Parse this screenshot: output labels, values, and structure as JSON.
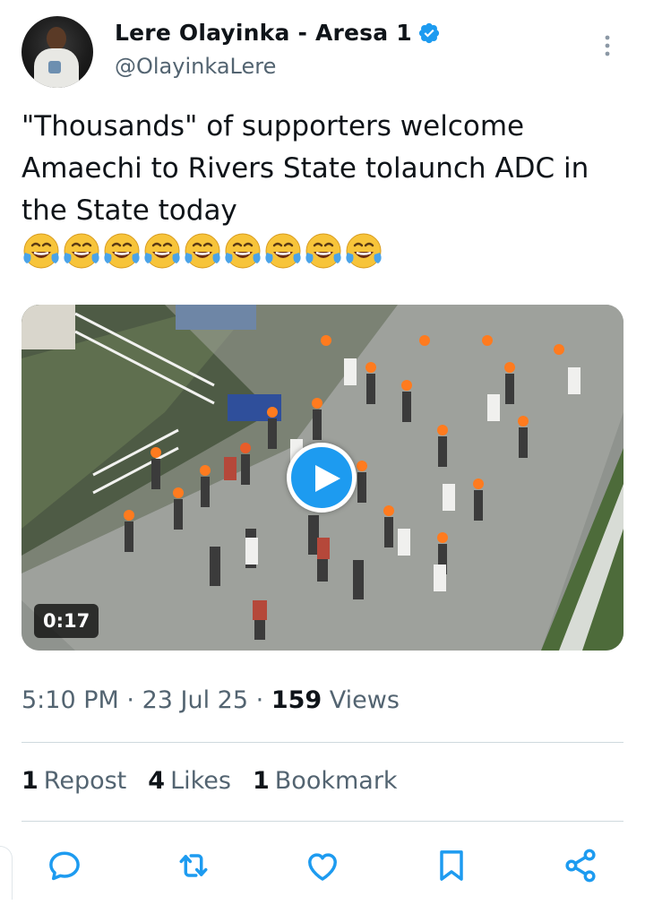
{
  "author": {
    "display_name": "Lere Olayinka - Aresa 1",
    "handle": "@OlayinkaLere",
    "verified": true,
    "avatar_icon": "profile-photo"
  },
  "tweet": {
    "text": "\"Thousands\" of supporters welcome Amaechi to Rivers State tolaunch ADC in the State today",
    "emojis": [
      "😂",
      "😂",
      "😂",
      "😂",
      "😂",
      "😂",
      "😂",
      "😂",
      "😂"
    ]
  },
  "media": {
    "type": "video",
    "duration": "0:17",
    "play_icon": "play-icon"
  },
  "meta": {
    "time": "5:10 PM",
    "separator": "·",
    "date": "23 Jul 25",
    "views_count": "159",
    "views_label": "Views"
  },
  "stats": {
    "reposts_count": "1",
    "reposts_label": "Repost",
    "likes_count": "4",
    "likes_label": "Likes",
    "bookmarks_count": "1",
    "bookmarks_label": "Bookmark"
  },
  "actions": [
    "reply-icon",
    "repost-icon",
    "like-icon",
    "bookmark-icon",
    "share-icon"
  ],
  "colors": {
    "accent": "#1d9bf0",
    "text": "#0f1419",
    "secondary": "#536471",
    "divider": "#cfd9de"
  }
}
